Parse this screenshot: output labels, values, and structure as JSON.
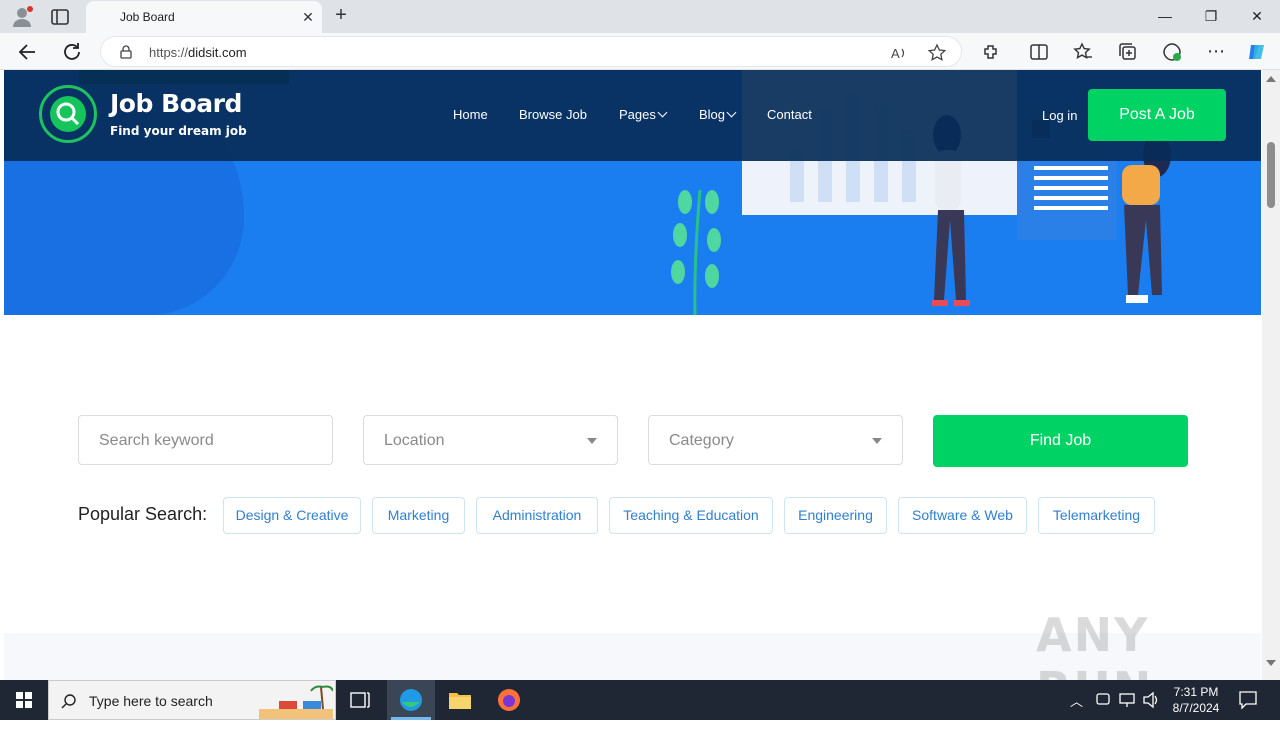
{
  "browser": {
    "tab_title": "Job Board",
    "url_prefix": "https://",
    "url_host": "didsit.com",
    "window_controls": [
      "—",
      "❐",
      "✕"
    ]
  },
  "site": {
    "brand": "Job Board",
    "tagline": "Find your dream job",
    "nav": {
      "home": "Home",
      "browse": "Browse Job",
      "pages": "Pages",
      "blog": "Blog",
      "contact": "Contact"
    },
    "login": "Log in",
    "post_job": "Post A Job"
  },
  "search": {
    "keyword_placeholder": "Search keyword",
    "location_label": "Location",
    "category_label": "Category",
    "find_button": "Find Job",
    "popular_label": "Popular Search:",
    "chips": [
      "Design & Creative",
      "Marketing",
      "Administration",
      "Teaching & Education",
      "Engineering",
      "Software & Web",
      "Telemarketing"
    ]
  },
  "watermark": "ANY RUN",
  "taskbar": {
    "search_placeholder": "Type here to search",
    "time": "7:31 PM",
    "date": "8/7/2024"
  },
  "colors": {
    "accent_green": "#00d363",
    "hero_blue": "#1a7ef0",
    "header_navy": "#072d58",
    "chip_text": "#2f7fd2"
  }
}
